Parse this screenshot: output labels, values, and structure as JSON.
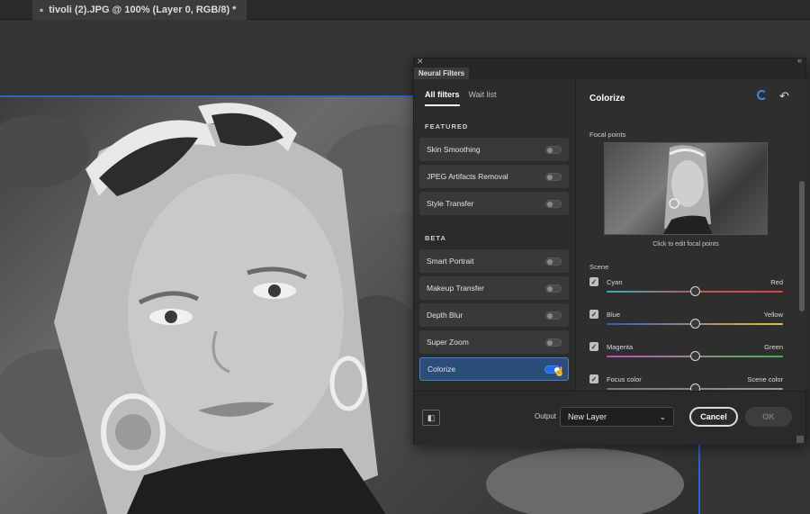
{
  "document": {
    "tab_title": "tivoli (2).JPG @ 100% (Layer 0, RGB/8) *",
    "close_glyph": "▪"
  },
  "panel": {
    "title": "Neural Filters",
    "tabs": [
      {
        "label": "All filters",
        "active": true
      },
      {
        "label": "Wait list",
        "active": false
      }
    ],
    "sections": {
      "featured": "FEATURED",
      "beta": "BETA"
    },
    "featured_filters": [
      {
        "label": "Skin Smoothing",
        "on": false
      },
      {
        "label": "JPEG Artifacts Removal",
        "on": false
      },
      {
        "label": "Style Transfer",
        "on": false
      }
    ],
    "beta_filters": [
      {
        "label": "Smart Portrait",
        "on": false
      },
      {
        "label": "Makeup Transfer",
        "on": false
      },
      {
        "label": "Depth Blur",
        "on": false
      },
      {
        "label": "Super Zoom",
        "on": false
      },
      {
        "label": "Colorize",
        "on": true
      }
    ],
    "detail": {
      "title": "Colorize",
      "focal_label": "Focal points",
      "focal_caption": "Click to edit focal points",
      "scene_label": "Scene",
      "sliders": [
        {
          "left": "Cyan",
          "right": "Red",
          "checked": true,
          "value": 0.5,
          "gradient": "linear-gradient(90deg,#2fb3b3,#b85a5a,#d6453f)"
        },
        {
          "left": "Blue",
          "right": "Yellow",
          "checked": true,
          "value": 0.5,
          "gradient": "linear-gradient(90deg,#3a57c9,#9a8a78,#d8c53a)"
        },
        {
          "left": "Magenta",
          "right": "Green",
          "checked": true,
          "value": 0.5,
          "gradient": "linear-gradient(90deg,#c04fb8,#8a8a8a,#3fb54a)"
        },
        {
          "left": "Focus color",
          "right": "Scene color",
          "checked": true,
          "value": 0.5,
          "gradient": "linear-gradient(90deg,#777,#999)"
        }
      ]
    },
    "footer": {
      "output_label": "Output",
      "output_value": "New Layer",
      "cancel_label": "Cancel",
      "ok_label": "OK"
    }
  },
  "colors": {
    "accent": "#1f6fe5",
    "selected_item": "#2b4d78"
  }
}
